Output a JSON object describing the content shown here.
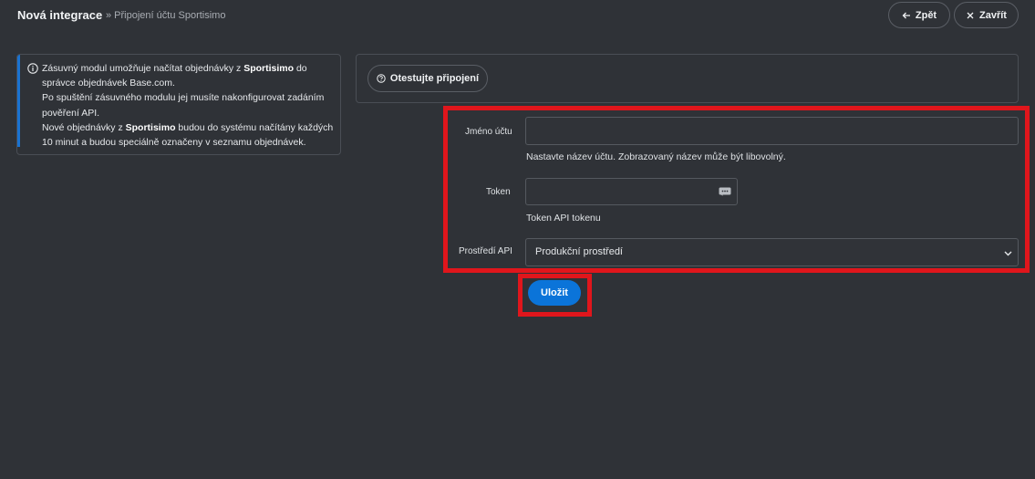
{
  "header": {
    "title": "Nová integrace",
    "breadcrumb": "» Připojení účtu Sportisimo",
    "back_label": "Zpět",
    "close_label": "Zavřít"
  },
  "info": {
    "line1_pre": "Zásuvný modul umožňuje načítat objednávky z ",
    "line1_bold": "Sportisimo",
    "line1_post": " do správce objednávek Base.com.",
    "line2": "Po spuštění zásuvného modulu jej musíte nakonfigurovat zadáním pověření API.",
    "line3_pre": "Nové objednávky z ",
    "line3_bold": "Sportisimo",
    "line3_post": " budou do systému načítány každých 10 minut a budou speciálně označeny v seznamu objednávek."
  },
  "test_connection": {
    "label": "Otestujte připojení"
  },
  "form": {
    "account_name": {
      "label": "Jméno účtu",
      "value": "",
      "help": "Nastavte název účtu. Zobrazovaný název může být libovolný."
    },
    "token": {
      "label": "Token",
      "value": "",
      "help": "Token API tokenu"
    },
    "environment": {
      "label": "Prostředí API",
      "selected": "Produkční prostředí"
    }
  },
  "save": {
    "label": "Uložit"
  },
  "colors": {
    "background": "#2f3237",
    "accent": "#0b74d9",
    "highlight": "#e0161c",
    "info_bar": "#1a73d1"
  }
}
